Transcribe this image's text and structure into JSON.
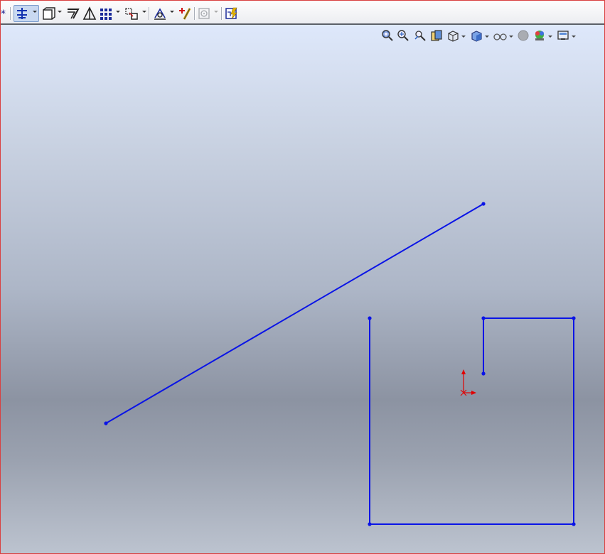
{
  "window": {
    "frame_color": "#d94040",
    "viewport_gradient": [
      "#dee8fb",
      "#c9d2e2",
      "#adb6c7",
      "#8c93a2",
      "#9aa1af",
      "#bcc3cf"
    ]
  },
  "toolbar": {
    "items": [
      {
        "name": "smart-dimension-icon",
        "active": false
      },
      {
        "name": "sketch-relations-icon",
        "active": true
      },
      {
        "name": "view-orientation-icon",
        "active": false
      },
      {
        "name": "offset-entities-icon",
        "active": false
      },
      {
        "name": "mirror-entities-icon",
        "active": false
      },
      {
        "name": "linear-pattern-icon",
        "active": false
      },
      {
        "name": "move-entities-icon",
        "active": false
      },
      {
        "name": "display-relations-icon",
        "active": false
      },
      {
        "name": "repair-sketch-icon",
        "active": false
      },
      {
        "name": "circular-sketch-icon",
        "active": false
      },
      {
        "name": "rapid-sketch-icon",
        "active": false
      }
    ]
  },
  "heads_up_toolbar": {
    "items": [
      "zoom-to-fit-icon",
      "zoom-to-area-icon",
      "previous-view-icon",
      "section-view-icon",
      "view-orientation-icon",
      "display-style-icon",
      "hide-show-items-icon",
      "edit-appearance-icon",
      "apply-scene-icon",
      "view-settings-icon"
    ]
  },
  "sketch": {
    "line_color": "#0a14e6",
    "origin_color": "#e00000",
    "entities": [
      {
        "type": "line",
        "name": "sketch-line-diagonal"
      },
      {
        "type": "polyline",
        "name": "sketch-profile-u-shape"
      }
    ]
  }
}
